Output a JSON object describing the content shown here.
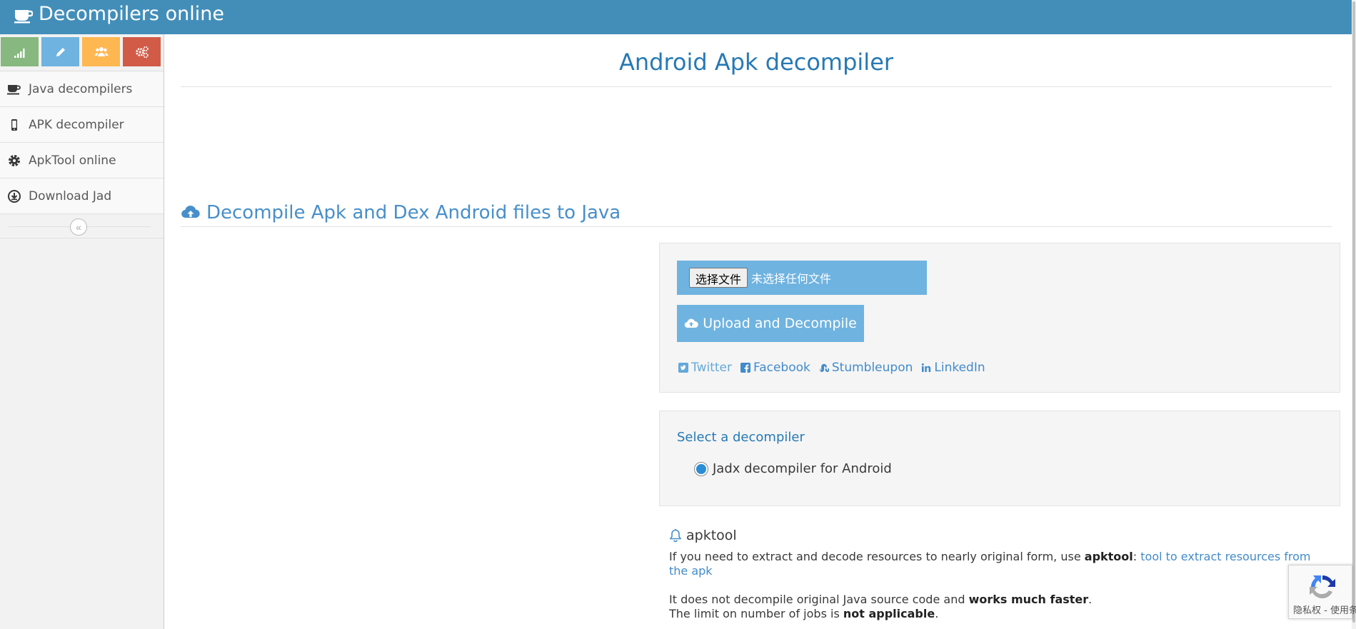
{
  "app": {
    "brand": "Decompilers online"
  },
  "sidebar": {
    "shortcuts": [
      {
        "icon": "signal-icon",
        "color": "#87b87f"
      },
      {
        "icon": "pencil-icon",
        "color": "#6fb3e0"
      },
      {
        "icon": "users-icon",
        "color": "#ffb752"
      },
      {
        "icon": "cogs-icon",
        "color": "#d15b47"
      }
    ],
    "items": [
      {
        "label": "Java decompilers",
        "icon": "coffee-icon"
      },
      {
        "label": "APK decompiler",
        "icon": "mobile-icon"
      },
      {
        "label": "ApkTool online",
        "icon": "gear-icon"
      },
      {
        "label": "Download Jad",
        "icon": "download-icon"
      }
    ],
    "collapse_icon": "double-angle-left-icon"
  },
  "main": {
    "page_title": "Android Apk decompiler",
    "section_title": "Decompile Apk and Dex Android files to Java",
    "upload": {
      "choose_file_label": "选择文件",
      "file_status": "未选择任何文件",
      "upload_button_label": "Upload and Decompile"
    },
    "share": [
      {
        "label": "Twitter",
        "icon": "twitter-icon"
      },
      {
        "label": "Facebook",
        "icon": "facebook-icon"
      },
      {
        "label": "Stumbleupon",
        "icon": "stumbleupon-icon"
      },
      {
        "label": "LinkedIn",
        "icon": "linkedin-icon"
      }
    ],
    "decompiler": {
      "title": "Select a decompiler",
      "options": [
        {
          "label": "Jadx decompiler for Android",
          "selected": true
        }
      ]
    },
    "apktool": {
      "heading": "apktool",
      "line1_prefix": "If you need to extract and decode resources to nearly original form, use ",
      "line1_bold": "apktool",
      "line1_sep": ": ",
      "line1_link": "tool to extract resources from the apk",
      "line2_prefix": "It does not decompile original Java source code and ",
      "line2_bold": "works much faster",
      "line2_suffix": ".",
      "line3_prefix": "The limit on number of jobs is ",
      "line3_bold": "not applicable",
      "line3_suffix": "."
    }
  },
  "recaptcha": {
    "text": "隐私权 - 使用条款"
  },
  "colors": {
    "navbar": "#438eb9",
    "accent_blue": "#6fb3e0",
    "title_blue": "#2679b5",
    "link_blue": "#428bca"
  }
}
